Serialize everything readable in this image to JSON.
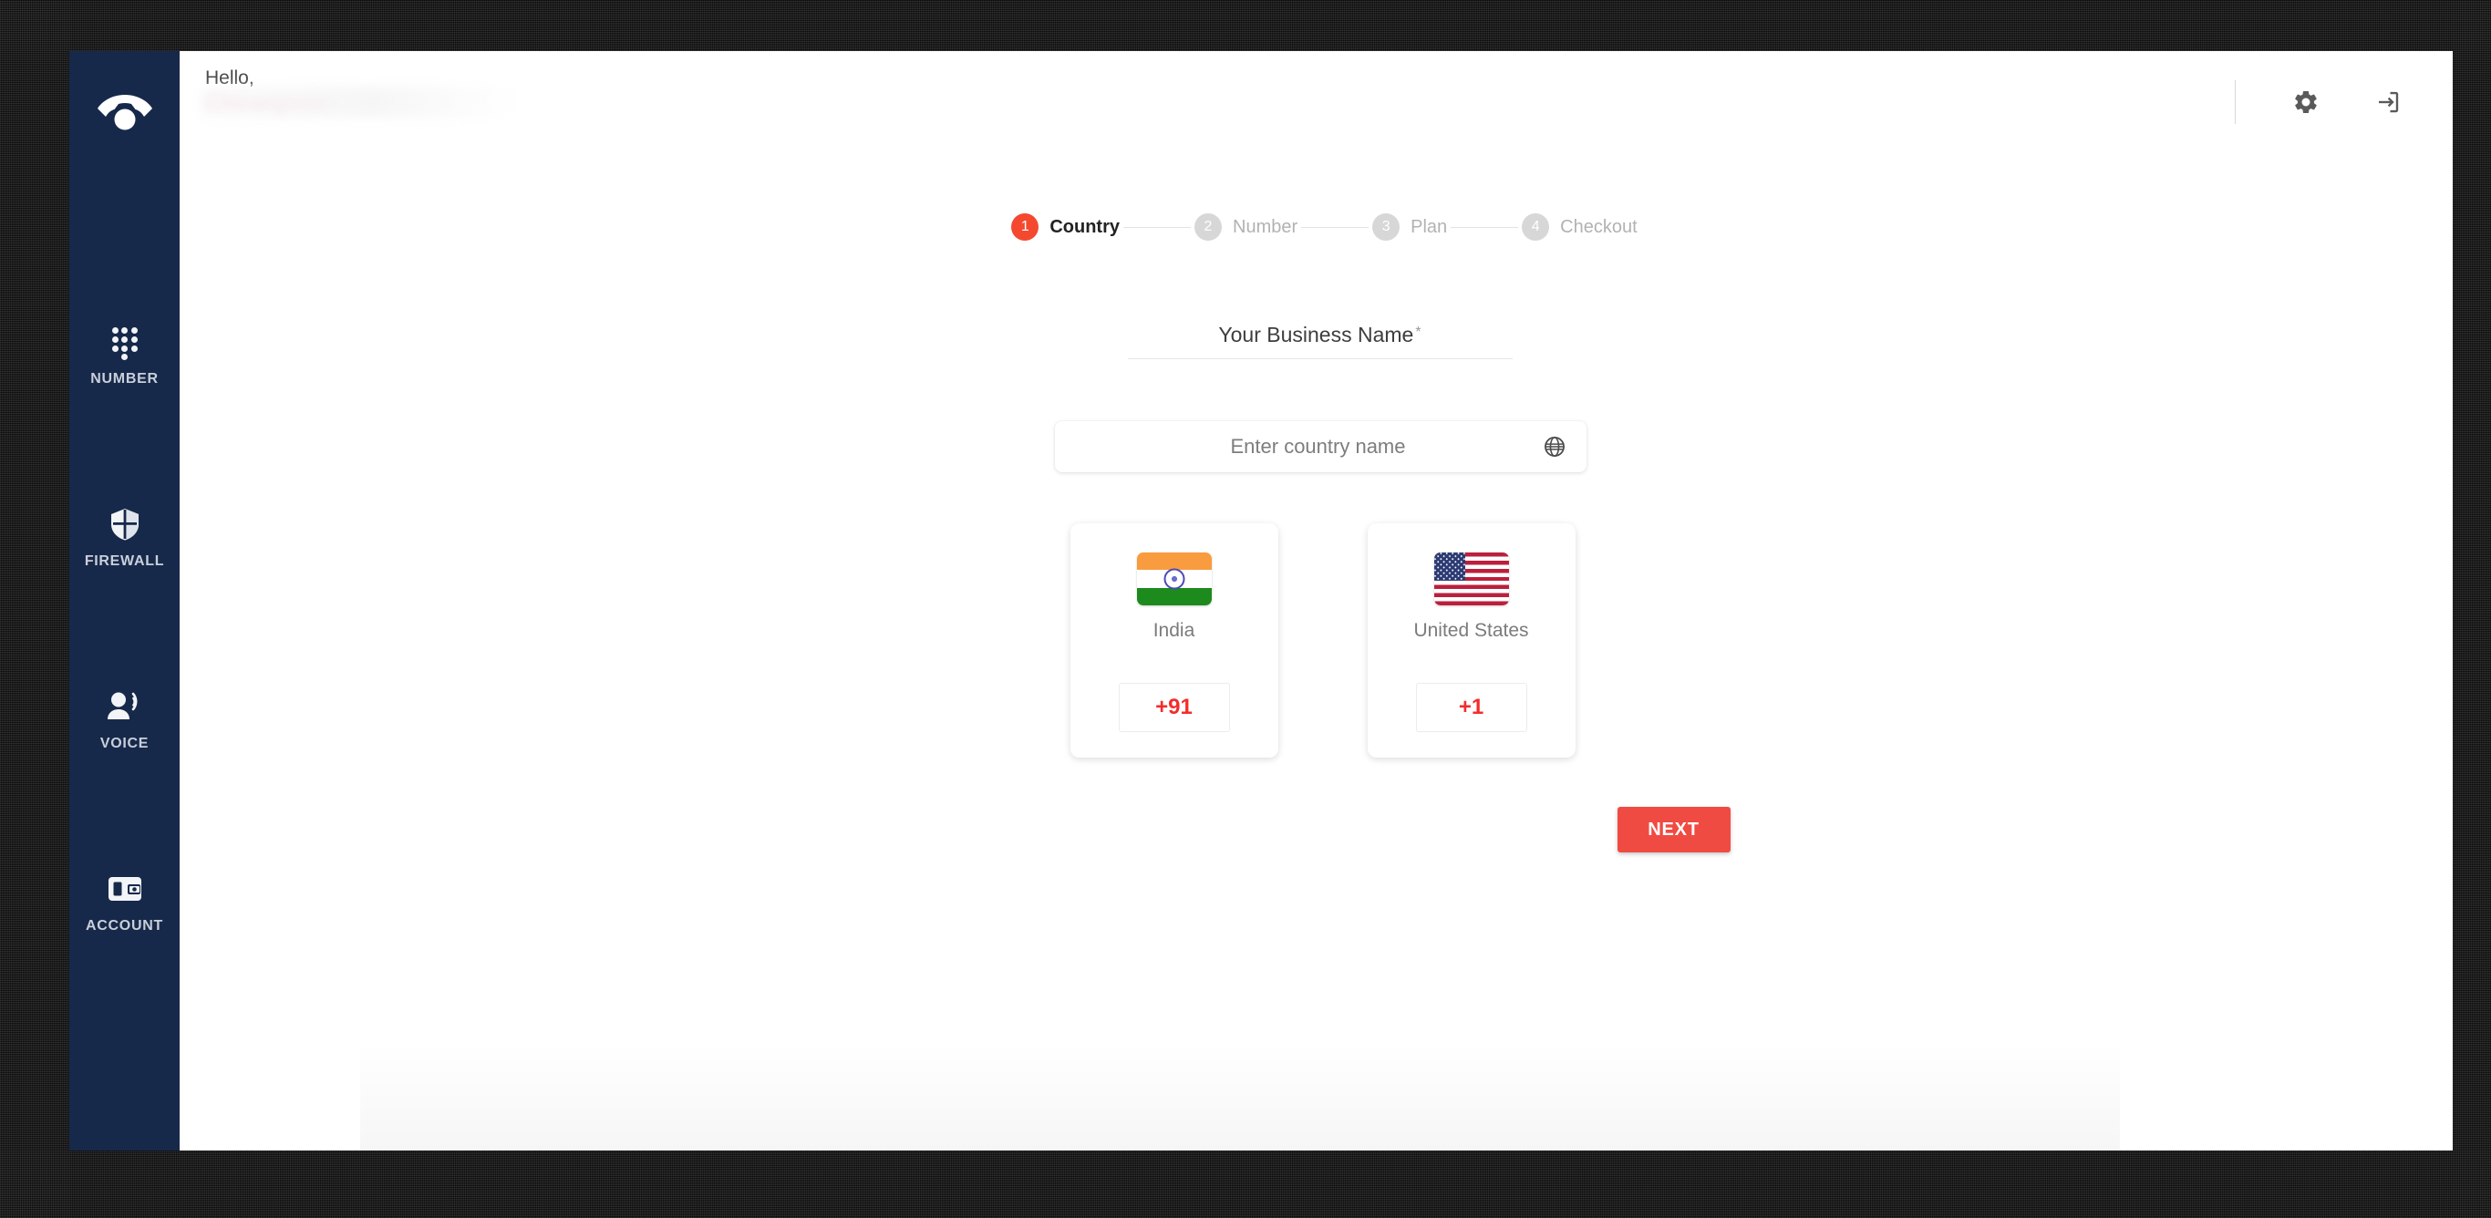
{
  "app": {
    "brand_icon": "phone-ring-icon"
  },
  "sidebar": {
    "items": [
      {
        "label": "NUMBER",
        "icon": "dialpad-icon"
      },
      {
        "label": "FIREWALL",
        "icon": "shield-icon"
      },
      {
        "label": "VOICE",
        "icon": "record-voice-over-icon"
      },
      {
        "label": "ACCOUNT",
        "icon": "wallet-icon"
      }
    ]
  },
  "header": {
    "greeting": "Hello,",
    "username": "Chiranjeevi",
    "settings_icon": "gear-icon",
    "logout_icon": "logout-icon"
  },
  "stepper": {
    "steps": [
      {
        "number": "1",
        "label": "Country",
        "active": true
      },
      {
        "number": "2",
        "label": "Number",
        "active": false
      },
      {
        "number": "3",
        "label": "Plan",
        "active": false
      },
      {
        "number": "4",
        "label": "Checkout",
        "active": false
      }
    ]
  },
  "form": {
    "business_name": {
      "label": "Your Business Name",
      "required_marker": "*",
      "value": "",
      "placeholder": ""
    },
    "country_search": {
      "placeholder": "Enter country name",
      "value": "",
      "icon": "globe-icon"
    },
    "countries": [
      {
        "name": "India",
        "dial_code": "+91",
        "flag": "flag-india"
      },
      {
        "name": "United States",
        "dial_code": "+1",
        "flag": "flag-united-states"
      }
    ],
    "next_label": "NEXT"
  },
  "colors": {
    "sidebar_bg": "#17294a",
    "accent_red": "#f04b42",
    "step_active": "#f4492f",
    "dial_code_red": "#f22d2d",
    "username_red": "#e9657b"
  }
}
